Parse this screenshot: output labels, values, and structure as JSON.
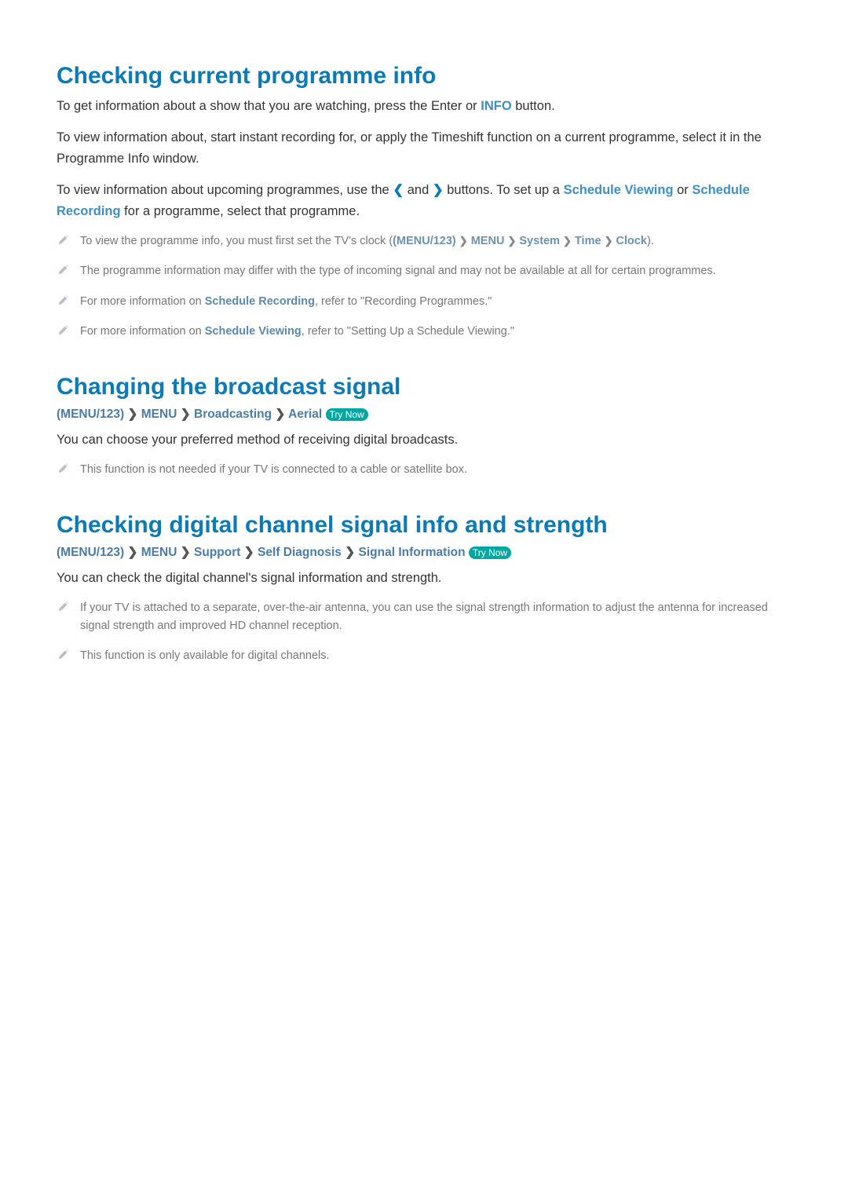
{
  "section1": {
    "title": "Checking current programme info",
    "para1_pre": "To get information about a show that you are watching, press the Enter or ",
    "para1_info": "INFO",
    "para1_post": " button.",
    "para2": "To view information about, start instant recording for, or apply the Timeshift function on a current programme, select it in the Programme Info window.",
    "para3_pre": "To view information about upcoming programmes, use the ",
    "para3_mid": " and ",
    "para3_post1": " buttons. To set up a ",
    "para3_sv": "Schedule Viewing",
    "para3_or": " or ",
    "para3_sr": "Schedule Recording",
    "para3_post2": " for a programme, select that programme.",
    "note1_pre": "To view the programme info, you must first set the TV's clock (",
    "note1_p1": "(MENU/123)",
    "note1_p2": "MENU",
    "note1_p3": "System",
    "note1_p4": "Time",
    "note1_p5": "Clock",
    "note1_post": ").",
    "note2": "The programme information may differ with the type of incoming signal and may not be available at all for certain programmes.",
    "note3_pre": "For more information on ",
    "note3_link": "Schedule Recording",
    "note3_post": ", refer to \"Recording Programmes.\"",
    "note4_pre": "For more information on ",
    "note4_link": "Schedule Viewing",
    "note4_post": ", refer to \"Setting Up a Schedule Viewing.\""
  },
  "section2": {
    "title": "Changing the broadcast signal",
    "path_p1": "(MENU/123)",
    "path_p2": "MENU",
    "path_p3": "Broadcasting",
    "path_p4": "Aerial",
    "try_now": "Try Now",
    "para1": "You can choose your preferred method of receiving digital broadcasts.",
    "note1": "This function is not needed if your TV is connected to a cable or satellite box."
  },
  "section3": {
    "title": "Checking digital channel signal info and strength",
    "path_p1": "(MENU/123)",
    "path_p2": "MENU",
    "path_p3": "Support",
    "path_p4": "Self Diagnosis",
    "path_p5": "Signal Information",
    "try_now": "Try Now",
    "para1": "You can check the digital channel's signal information and strength.",
    "note1": "If your TV is attached to a separate, over-the-air antenna, you can use the signal strength information to adjust the antenna for increased signal strength and improved HD channel reception.",
    "note2": "This function is only available for digital channels."
  }
}
